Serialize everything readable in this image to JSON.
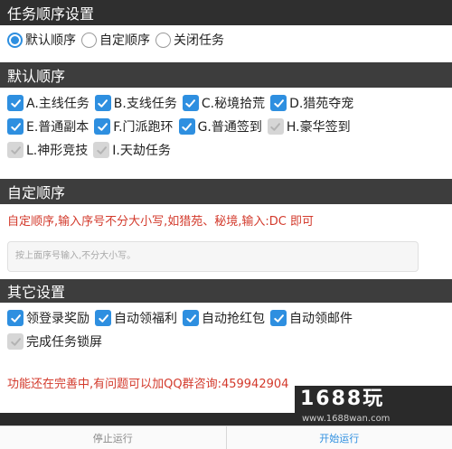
{
  "sections": {
    "task_order": "任务顺序设置",
    "default_order": "默认顺序",
    "custom_order": "自定顺序",
    "other_settings": "其它设置"
  },
  "mode": {
    "options": [
      "默认顺序",
      "自定顺序",
      "关闭任务"
    ],
    "selected": "默认顺序"
  },
  "default_tasks": [
    {
      "label": "A.主线任务",
      "checked": true
    },
    {
      "label": "B.支线任务",
      "checked": true
    },
    {
      "label": "C.秘境拾荒",
      "checked": true
    },
    {
      "label": "D.猎苑夺宠",
      "checked": true
    },
    {
      "label": "E.普通副本",
      "checked": true
    },
    {
      "label": "F.门派跑环",
      "checked": true
    },
    {
      "label": "G.普通签到",
      "checked": true
    },
    {
      "label": "H.豪华签到",
      "checked": false
    },
    {
      "label": "L.神形竞技",
      "checked": false
    },
    {
      "label": "I.天劫任务",
      "checked": false
    }
  ],
  "custom": {
    "hint": "自定顺序,输入序号不分大小写,如猎苑、秘境,输入:DC 即可",
    "placeholder": "按上面序号输入,不分大小写。"
  },
  "other": [
    {
      "label": "领登录奖励",
      "checked": true
    },
    {
      "label": "自动领福利",
      "checked": true
    },
    {
      "label": "自动抢红包",
      "checked": true
    },
    {
      "label": "自动领邮件",
      "checked": true
    },
    {
      "label": "完成任务锁屏",
      "checked": false
    }
  ],
  "notice": "功能还在完善中,有问题可以加QQ群咨询:459942904",
  "watermark": {
    "logo": "1688玩",
    "url": "www.1688wan.com"
  },
  "buttons": {
    "stop": "停止运行",
    "start": "开始运行"
  },
  "colors": {
    "accent": "#2e8fe0",
    "header": "#3d3d3d",
    "notice_red": "#d33a2c"
  }
}
